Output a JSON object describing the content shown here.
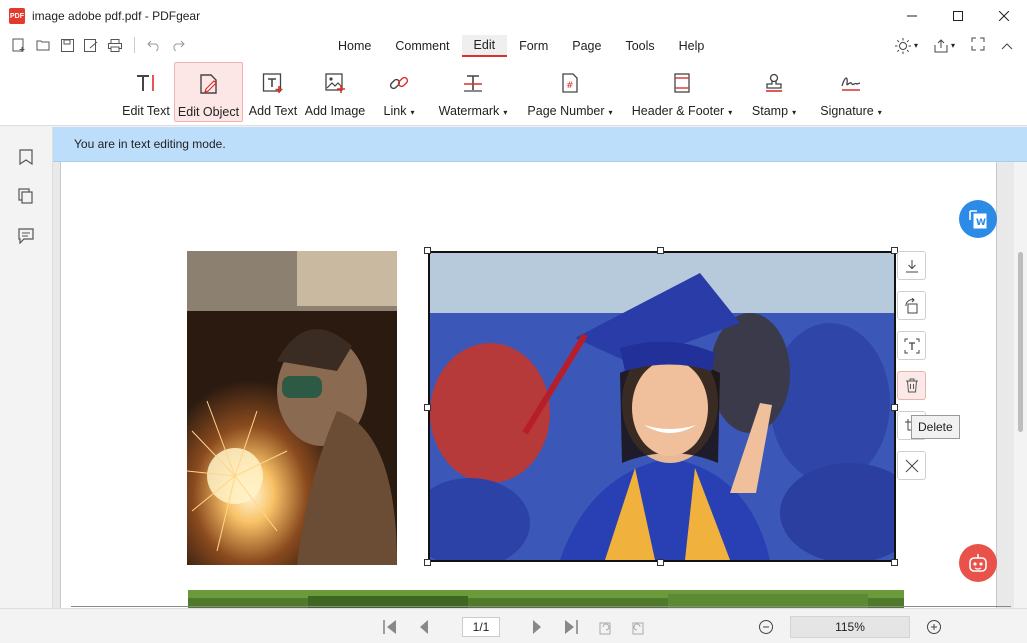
{
  "window": {
    "title": "image adobe pdf.pdf - PDFgear",
    "logo_text": "PDF"
  },
  "menu": {
    "tabs": [
      "Home",
      "Comment",
      "Edit",
      "Form",
      "Page",
      "Tools",
      "Help"
    ],
    "active_tab": "Edit"
  },
  "ribbon": {
    "edit_text": "Edit Text",
    "edit_object": "Edit Object",
    "add_text": "Add Text",
    "add_image": "Add Image",
    "link": "Link",
    "watermark": "Watermark",
    "page_number": "Page Number",
    "header_footer": "Header & Footer",
    "stamp": "Stamp",
    "signature": "Signature",
    "caret": "▾"
  },
  "banner": {
    "message": "You are in text editing mode."
  },
  "image_tools": {
    "tooltip": "Delete"
  },
  "status": {
    "page_indicator": "1/1",
    "zoom": "115%"
  },
  "colors": {
    "accent": "#d9302a",
    "banner": "#bcdefa",
    "convert_fab": "#2b8be6",
    "assistant_fab": "#e8524a"
  }
}
